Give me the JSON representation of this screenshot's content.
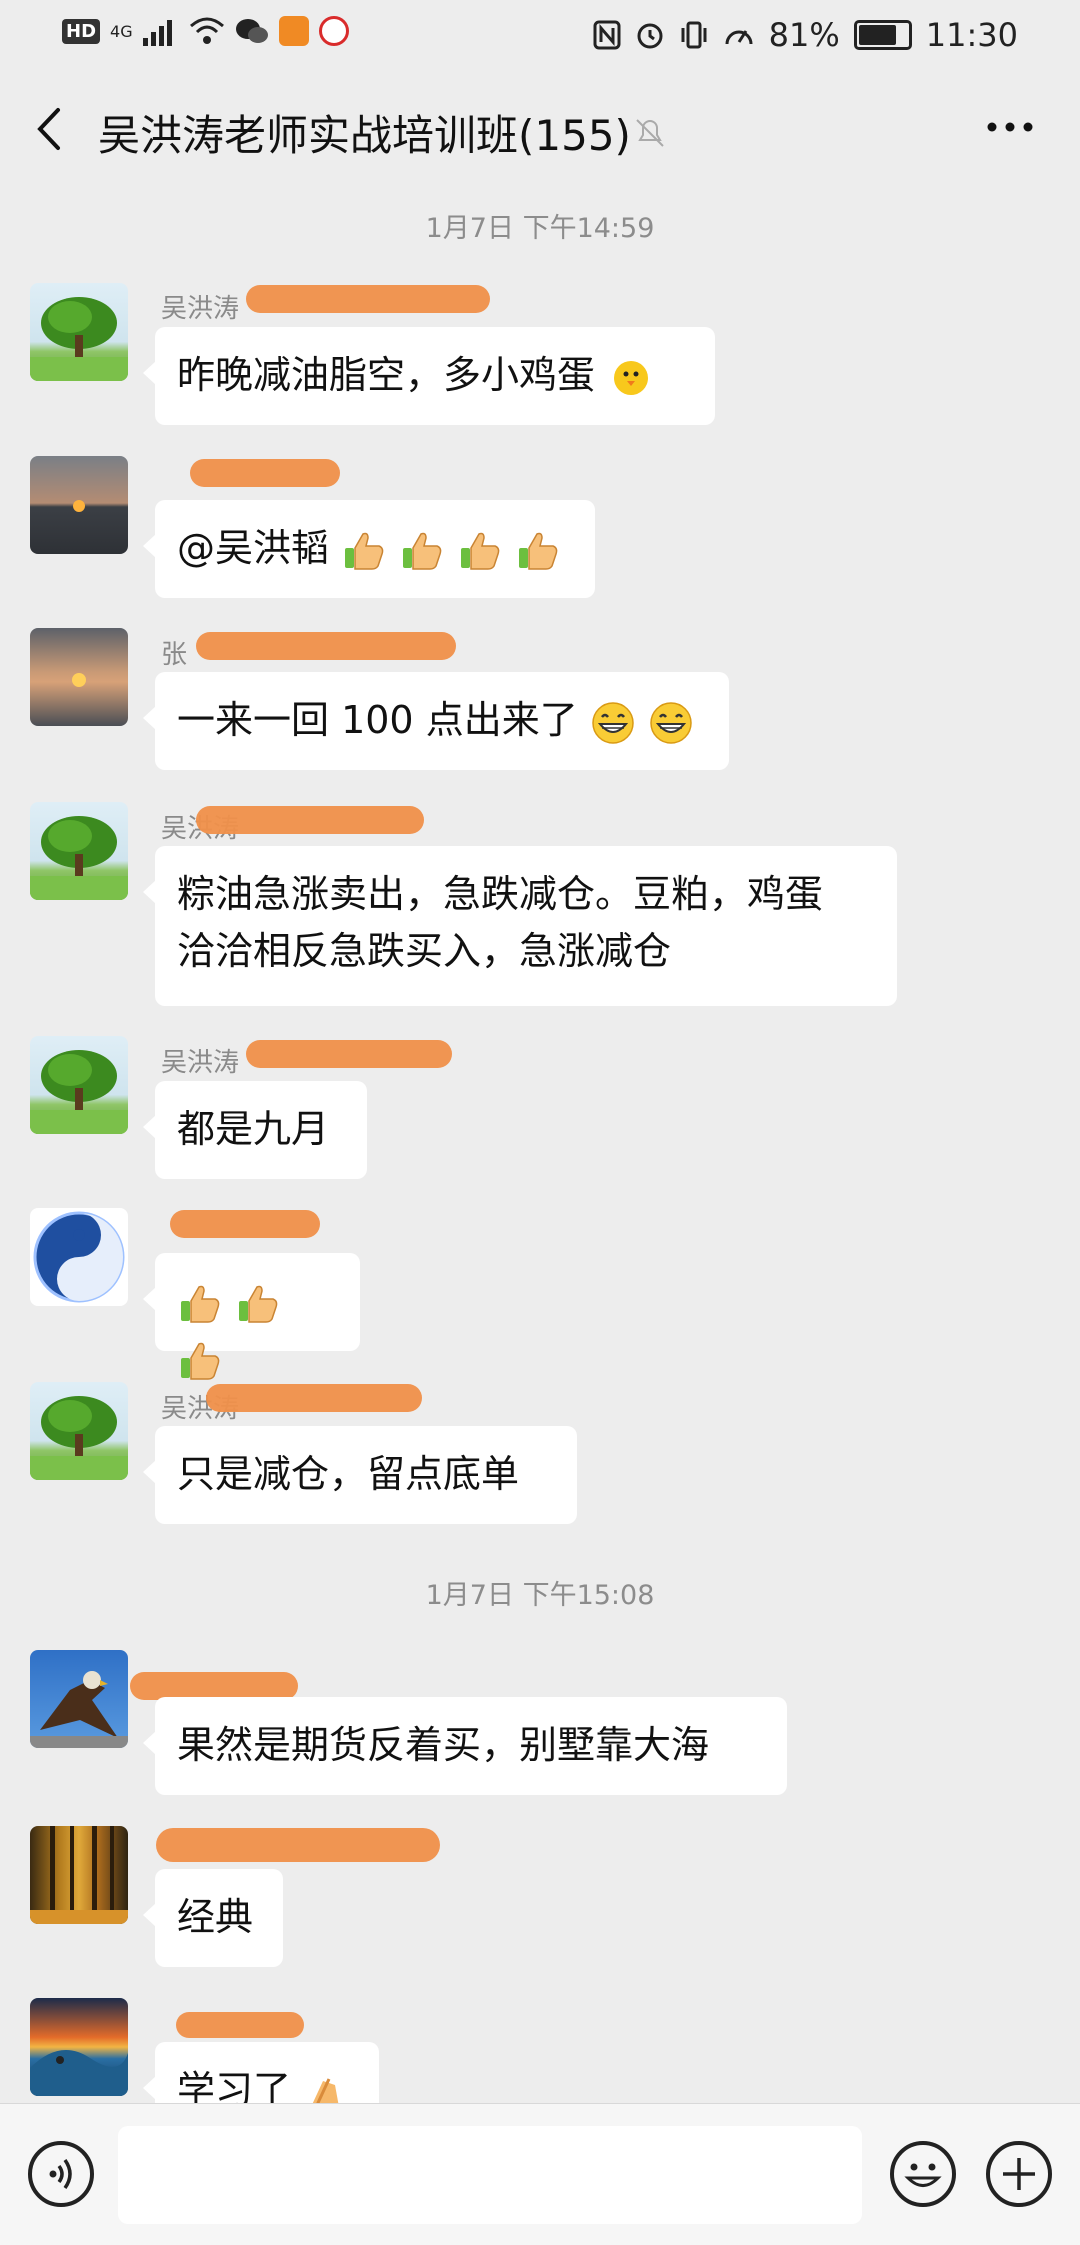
{
  "status_bar": {
    "hd": "HD",
    "network": "4G",
    "battery_percent": "81%",
    "battery_level": 0.81,
    "time": "11:30"
  },
  "header": {
    "title": "吴洪涛老师实战培训班(155)",
    "back_icon": "chevron-left-icon",
    "mute_icon": "bell-muted-icon",
    "more_icon": "more-dots-icon"
  },
  "timestamps": [
    "1月7日 下午14:59",
    "1月7日 下午15:08"
  ],
  "messages": [
    {
      "sender": "吴洪涛",
      "avatar": "tree",
      "text": "昨晚减油脂空，多小鸡蛋",
      "emoji": [
        "chick"
      ]
    },
    {
      "sender": "",
      "avatar": "sunset-sea",
      "text": "@吴洪韬",
      "emoji": [
        "thumbs-up",
        "thumbs-up",
        "thumbs-up",
        "thumbs-up"
      ]
    },
    {
      "sender": "张",
      "avatar": "sunset-cloud",
      "text": "一来一回 100 点出来了",
      "emoji": [
        "grin",
        "grin"
      ]
    },
    {
      "sender": "吴洪涛",
      "avatar": "tree",
      "text": "粽油急涨卖出，急跌减仓。豆粕，鸡蛋",
      "text2": "洽洽相反急跌买入，急涨减仓",
      "emoji": []
    },
    {
      "sender": "吴洪涛",
      "avatar": "tree",
      "text": "都是九月",
      "emoji": []
    },
    {
      "sender": "",
      "avatar": "yin-yang",
      "text": "",
      "emoji": [
        "thumbs-up",
        "thumbs-up",
        "thumbs-up"
      ]
    },
    {
      "sender": "吴洪涛",
      "avatar": "tree",
      "text": "只是减仓，留点底单",
      "emoji": []
    },
    {
      "sender": "",
      "avatar": "eagle",
      "text": "果然是期货反着买，别墅靠大海",
      "emoji": []
    },
    {
      "sender": "",
      "avatar": "autumn-forest",
      "text": "经典",
      "emoji": []
    },
    {
      "sender": "",
      "avatar": "wave",
      "text": "学习了",
      "emoji": [
        "clap"
      ]
    }
  ],
  "input_bar": {
    "voice_icon": "voice-icon",
    "emoji_icon": "smiley-icon",
    "plus_icon": "plus-icon",
    "placeholder": ""
  },
  "colors": {
    "background": "#ededed",
    "bubble": "#ffffff",
    "redaction": "#f0904a"
  }
}
